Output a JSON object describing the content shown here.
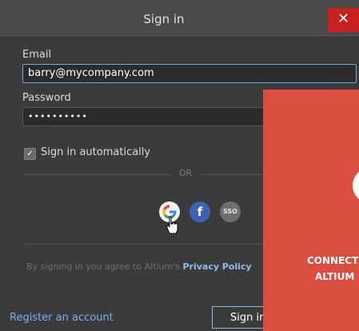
{
  "window": {
    "title": "Sign in",
    "close_glyph": "✕"
  },
  "form": {
    "email_label": "Email",
    "email_value": "barry@mycompany.com",
    "password_label": "Password",
    "password_value": "••••••••••",
    "remember_label": "Sign in automatically",
    "remember_checked": true,
    "or_text": "OR"
  },
  "social": {
    "google_glyph": "G",
    "facebook_glyph": "f",
    "sso_label": "SSO"
  },
  "legal": {
    "agree_text": "By signing in you agree to Altium's ",
    "privacy_link": "Privacy Policy"
  },
  "footer": {
    "register_link": "Register an account",
    "signin_button": "Sign in"
  },
  "promo": {
    "line1": "CONNECT",
    "line2": "ALTIUM"
  },
  "colors": {
    "dialog_bg": "#3b3b3b",
    "close_red": "#c81f1f",
    "link_blue": "#78aef0",
    "promo_red": "#db4d40",
    "facebook_blue": "#3b62b3"
  },
  "icons": [
    "close-icon",
    "check-icon",
    "google-icon",
    "facebook-icon",
    "sso-icon",
    "hand-cursor-icon"
  ]
}
